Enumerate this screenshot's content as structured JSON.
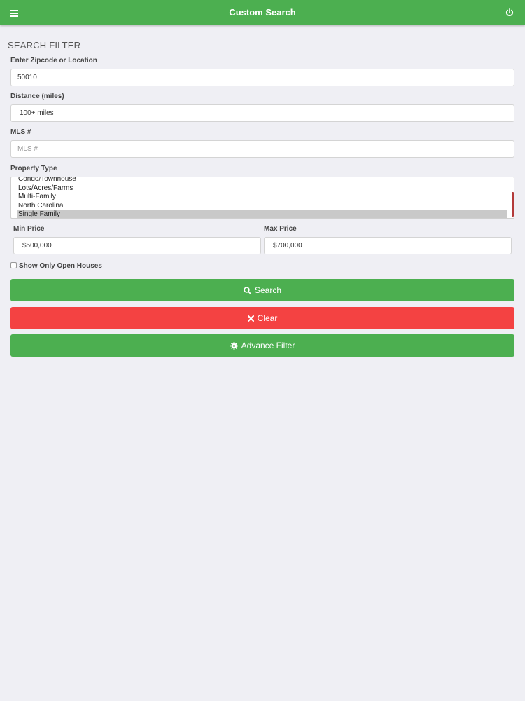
{
  "header": {
    "title": "Custom Search",
    "menu_icon": "hamburger-menu-icon",
    "power_icon": "power-icon",
    "bg_color": "#4caf50"
  },
  "filter": {
    "section_title": "SEARCH FILTER",
    "zipcode": {
      "label": "Enter Zipcode or Location",
      "value": "50010"
    },
    "distance": {
      "label": "Distance (miles)",
      "value": "100+ miles"
    },
    "mls": {
      "label": "MLS #",
      "placeholder": "MLS #"
    },
    "property_type": {
      "label": "Property Type",
      "options": [
        "Condo/Townhouse",
        "Lots/Acres/Farms",
        "Multi-Family",
        "North Carolina",
        "Single Family"
      ],
      "selected": "Single Family"
    },
    "min_price": {
      "label": "Min Price",
      "value": "$500,000"
    },
    "max_price": {
      "label": "Max Price",
      "value": "$700,000"
    },
    "open_houses": {
      "label": "Show Only Open Houses",
      "checked": false
    }
  },
  "actions": {
    "search": {
      "label": "Search",
      "icon": "search-icon",
      "color": "#4caf50"
    },
    "clear": {
      "label": "Clear",
      "icon": "close-icon",
      "color": "#f44242"
    },
    "advance": {
      "label": "Advance Filter",
      "icon": "gear-icon",
      "color": "#4caf50"
    }
  }
}
